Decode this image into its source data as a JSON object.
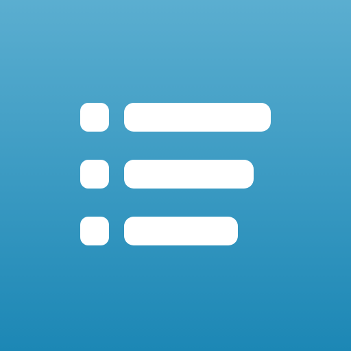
{
  "icon": {
    "name": "list-icon",
    "background_top": "#5BAED0",
    "background_bottom": "#1C87B5",
    "glyph_color": "#FFFFFF",
    "rows": 3
  }
}
